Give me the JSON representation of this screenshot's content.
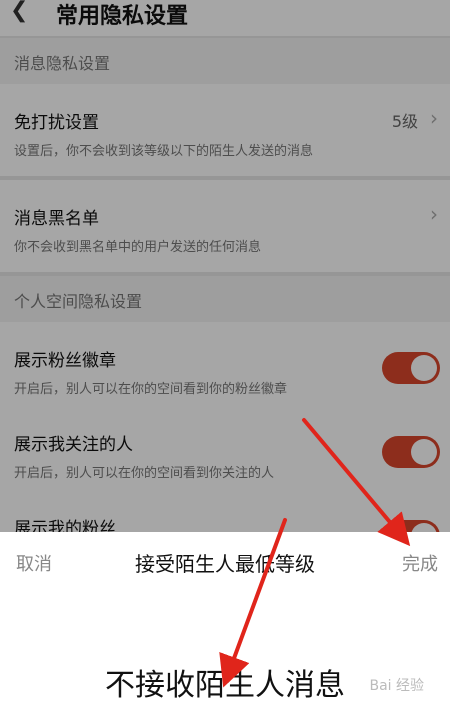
{
  "header": {
    "back_icon": "chevron-left-icon",
    "title": "常用隐私设置"
  },
  "sections": [
    {
      "label": "消息隐私设置"
    },
    {
      "label": "个人空间隐私设置"
    }
  ],
  "rows": [
    {
      "title": "免打扰设置",
      "desc": "设置后，你不会收到该等级以下的陌生人发送的消息",
      "value": "5级"
    },
    {
      "title": "消息黑名单",
      "desc": "你不会收到黑名单中的用户发送的任何消息"
    },
    {
      "title": "展示粉丝徽章",
      "desc": "开启后，别人可以在你的空间看到你的粉丝徽章",
      "on": true
    },
    {
      "title": "展示我关注的人",
      "desc": "开启后，别人可以在你的空间看到你关注的人",
      "on": true
    },
    {
      "title": "展示我的粉丝",
      "on": true
    }
  ],
  "picker": {
    "cancel": "取消",
    "title": "接受陌生人最低等级",
    "done": "完成",
    "selected_option": "不接收陌生人消息"
  },
  "colors": {
    "toggle_on": "#d9462c",
    "arrow": "#e0251b"
  },
  "watermark": "Bai 经验"
}
